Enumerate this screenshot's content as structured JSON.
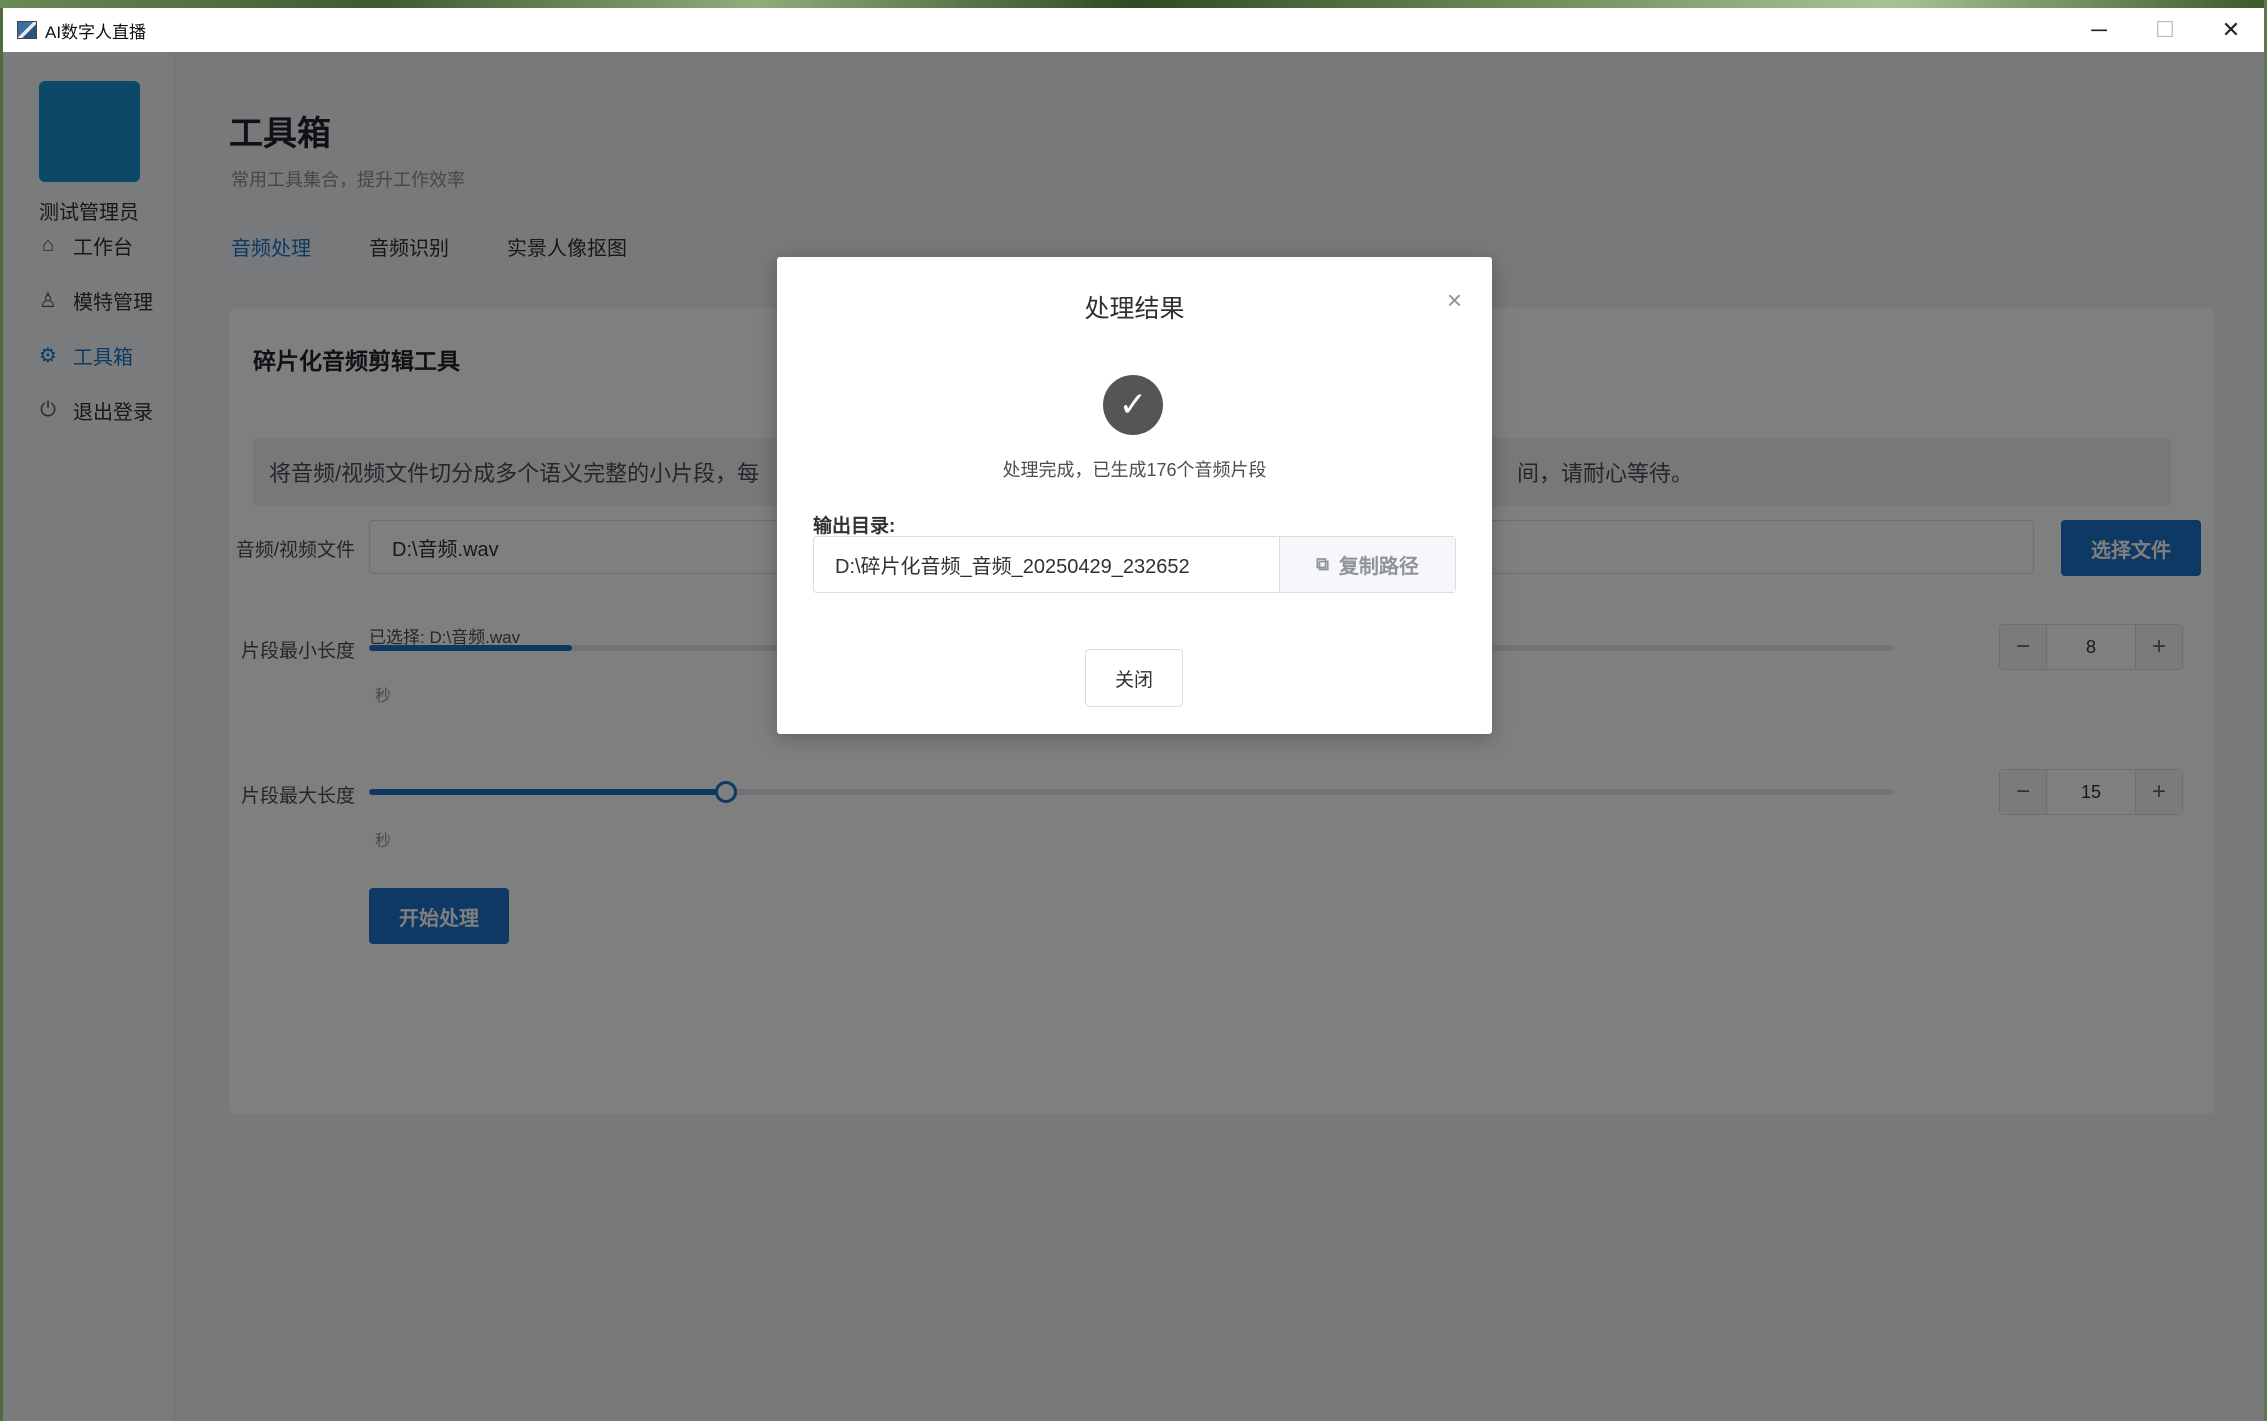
{
  "window": {
    "title": "AI数字人直播",
    "controls": {
      "minimize": "─",
      "maximize": "☐",
      "close": "✕"
    }
  },
  "sidebar": {
    "username": "测试管理员",
    "items": [
      {
        "label": "工作台",
        "icon": "home-icon",
        "glyph": "⌂"
      },
      {
        "label": "模特管理",
        "icon": "user-icon",
        "glyph": "♙"
      },
      {
        "label": "工具箱",
        "icon": "gear-icon",
        "glyph": "⚙",
        "active": true
      },
      {
        "label": "退出登录",
        "icon": "power-icon",
        "glyph": "⏻"
      }
    ]
  },
  "header": {
    "title": "工具箱",
    "subtitle": "常用工具集合，提升工作效率"
  },
  "tabs": [
    {
      "label": "音频处理",
      "active": true
    },
    {
      "label": "音频识别"
    },
    {
      "label": "实景人像抠图"
    }
  ],
  "tool": {
    "title": "碎片化音频剪辑工具",
    "description_start": "将音频/视频文件切分成多个语义完整的小片段，每",
    "description_end": "间，请耐心等待。",
    "file_label": "音频/视频文件",
    "file_value": "D:\\音频.wav",
    "choose_button": "选择文件",
    "selected_note": "已选择: D:\\音频.wav",
    "min_label": "片段最小长度",
    "min_value": "8",
    "max_label": "片段最大长度",
    "max_value": "15",
    "unit": "秒",
    "start_button": "开始处理",
    "minus": "−",
    "plus": "+"
  },
  "dialog": {
    "title": "处理结果",
    "close_glyph": "×",
    "check_glyph": "✓",
    "message": "处理完成，已生成176个音频片段",
    "output_label": "输出目录:",
    "output_path": "D:\\碎片化音频_音频_20250429_232652",
    "copy_button": "复制路径",
    "copy_glyph": "⧉",
    "close_button": "关闭"
  },
  "sliders": {
    "min": {
      "value": 8,
      "max": 60
    },
    "max": {
      "value": 15,
      "max": 64
    }
  },
  "colors": {
    "primary": "#1a73c8",
    "avatar": "#1890d0",
    "overlay": "rgba(0,0,0,0.5)"
  }
}
